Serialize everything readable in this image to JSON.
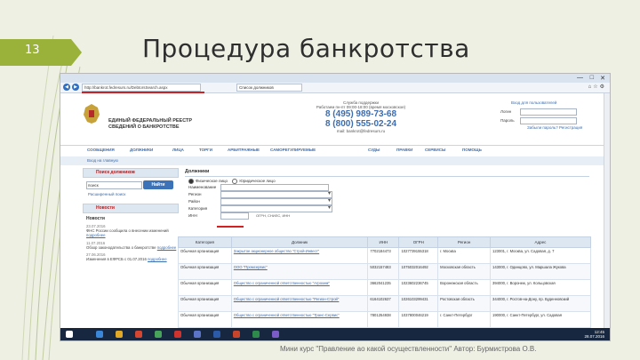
{
  "slide": {
    "number": "13",
    "title": "Процедура банкротства",
    "footer": "Мини курс \"Правление ао какой осуществленности\" Автор: Бурмистрова О.В."
  },
  "colors": {
    "accent": "#9bb23a",
    "link": "#3b6db0",
    "header_red": "#b02020",
    "button": "#3c72b8"
  },
  "browser": {
    "url": "http://bankrot.fedresurs.ru/DebtorsSearch.aspx",
    "tab_title": "Список должников",
    "controls": [
      "—",
      "□",
      "✕"
    ],
    "toolbar_icons": [
      "home-icon",
      "star-icon",
      "gear-icon"
    ]
  },
  "site": {
    "name": "ЕДИНЫЙ ФЕДЕРАЛЬНЫЙ РЕЕСТР СВЕДЕНИЙ О БАНКРОТСТВЕ",
    "support_title": "Служба поддержки",
    "support_hours": "Работаем пн-пт 09:00-18:00 (время московское)",
    "phone1": "8 (495) 989-73-68",
    "phone2": "8 (800) 555-02-24",
    "support_email": "mail: bankrot@fedresurs.ru",
    "login_link": "Вход для пользователей",
    "login_label": "Логин",
    "password_label": "Пароль",
    "login_links": "Забыли пароль?  Регистрация"
  },
  "menu": [
    "СООБЩЕНИЯ",
    "ДОЛЖНИКИ",
    "ЛИЦА",
    "ТОРГИ",
    "АРБИТРАЖНЫЕ",
    "САМОРЕГУЛИРУЕМЫЕ",
    "СУДЫ",
    "ПРАВКИ",
    "СЕРВИСЫ",
    "ПОМОЩЬ"
  ],
  "breadcrumb": "Вход на главную",
  "left_panel": {
    "search_header": "Поиск должников",
    "search_value": "поиск",
    "search_button": "Найти",
    "ext_search": "Расширенный поиск",
    "news_header": "Новости",
    "news_title": "Новости",
    "news": [
      {
        "date": "23.07.2016",
        "text": "ФНС России сообщила о внесении изменений",
        "link": "подробнее"
      },
      {
        "date": "11.07.2016",
        "text": "Обзор законодательства о банкротстве",
        "link": "подробнее"
      },
      {
        "date": "27.06.2016",
        "text": "Изменения в ЕФРСБ с 01.07.2016",
        "link": "подробнее"
      }
    ]
  },
  "debtors": {
    "header": "Должники",
    "radio_person": "Физическое лицо",
    "radio_company": "Юридическое лицо",
    "fields": [
      {
        "label": "Наименование"
      },
      {
        "label": "Регион"
      },
      {
        "label": "Район"
      },
      {
        "label": "Категория"
      },
      {
        "label": "ИНН"
      }
    ],
    "ogrn_hint": "ОГРН, СНИЛС, ИНН"
  },
  "table": {
    "headers": [
      "Категория",
      "Должник",
      "ИНН",
      "ОГРН",
      "Регион",
      "Адрес"
    ],
    "rows": [
      [
        "Обычная организация",
        "Закрытое акционерное общество \"Строй-Инвест\"",
        "7702184473",
        "1027739155318",
        "г. Москва",
        "123001, г. Москва, ул. Садовая, д. 7"
      ],
      [
        "Обычная организация",
        "ООО \"Промсервис\"",
        "5032157483",
        "1075032016492",
        "Московская область",
        "143000, г. Одинцово, ул. Маршала Жукова"
      ],
      [
        "Обычная организация",
        "Общество с ограниченной ответственностью \"Агрохим\"",
        "3662041235",
        "1023602236745",
        "Воронежская область",
        "394000, г. Воронеж, ул. Кольцовская"
      ],
      [
        "Обычная организация",
        "Общество с ограниченной ответственностью \"Регион-Строй\"",
        "6164102637",
        "1026103299431",
        "Ростовская область",
        "344000, г. Ростов-на-Дону, пр. Буденновский"
      ],
      [
        "Обычная организация",
        "Общество с ограниченной ответственностью \"Транс-Сервис\"",
        "7801254938",
        "1037800046219",
        "г. Санкт-Петербург",
        "190000, г. Санкт-Петербург, ул. Садовая"
      ]
    ]
  },
  "taskbar": {
    "time": "12:45",
    "date": "28.07.2016"
  }
}
